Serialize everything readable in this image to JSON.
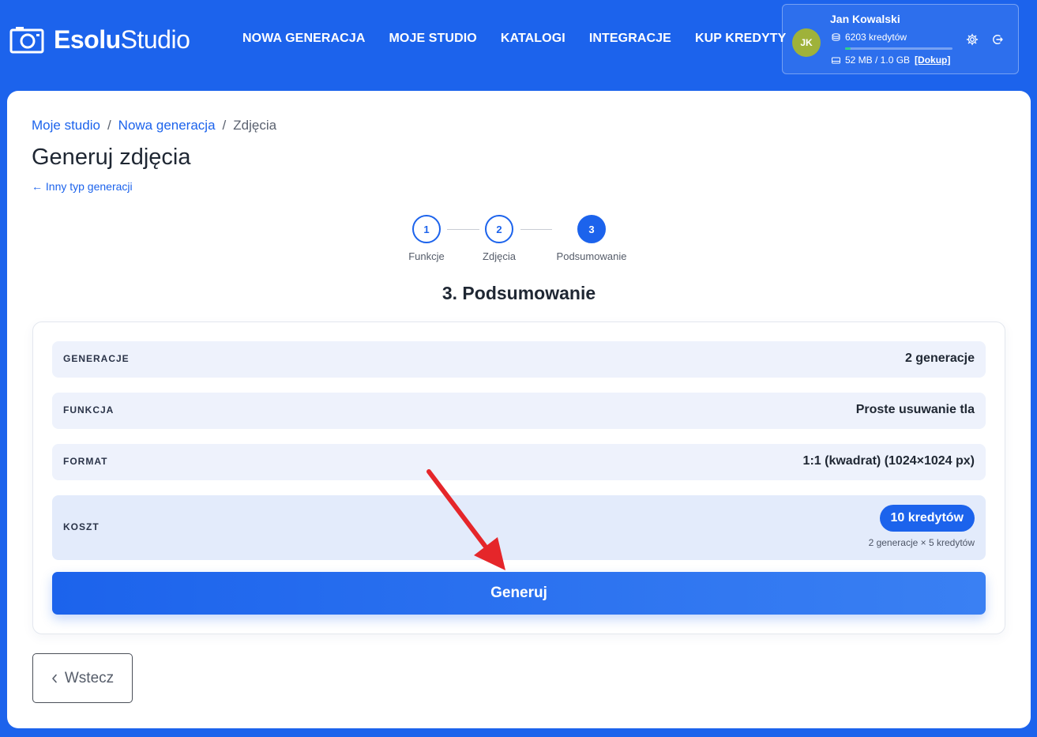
{
  "brand": {
    "name_bold": "Esolu",
    "name_regular": "Studio"
  },
  "nav": [
    {
      "label": "NOWA GENERACJA"
    },
    {
      "label": "MOJE STUDIO"
    },
    {
      "label": "KATALOGI"
    },
    {
      "label": "INTEGRACJE"
    },
    {
      "label": "KUP KREDYTY"
    }
  ],
  "user": {
    "initials": "JK",
    "name": "Jan Kowalski",
    "credits": "6203 kredytów",
    "storage": "52 MB / 1.0 GB",
    "topup": "[Dokup]",
    "storage_fraction": 0.05,
    "avatar_color": "#9fb23a"
  },
  "breadcrumb": [
    "Moje studio",
    "Nowa generacja",
    "Zdjęcia"
  ],
  "page_title": "Generuj zdjęcia",
  "back_link": "← Inny typ generacji",
  "steps": [
    {
      "num": "1",
      "label": "Funkcje",
      "active": false
    },
    {
      "num": "2",
      "label": "Zdjęcia",
      "active": false
    },
    {
      "num": "3",
      "label": "Podsumowanie",
      "active": true
    }
  ],
  "section_title": "3. Podsumowanie",
  "summary": {
    "rows": [
      {
        "label": "GENERACJE",
        "value": "2 generacje"
      },
      {
        "label": "FUNKCJA",
        "value": "Proste usuwanie tla"
      },
      {
        "label": "FORMAT",
        "value": "1:1 (kwadrat) (1024×1024 px)"
      }
    ],
    "cost": {
      "label": "KOSZT",
      "badge": "10 kredytów",
      "detail": "2 generacje × 5 kredytów"
    },
    "generate_label": "Generuj"
  },
  "back_button": "Wstecz",
  "colors": {
    "accent": "#1c63ec",
    "annotation_arrow": "#e5262a"
  }
}
